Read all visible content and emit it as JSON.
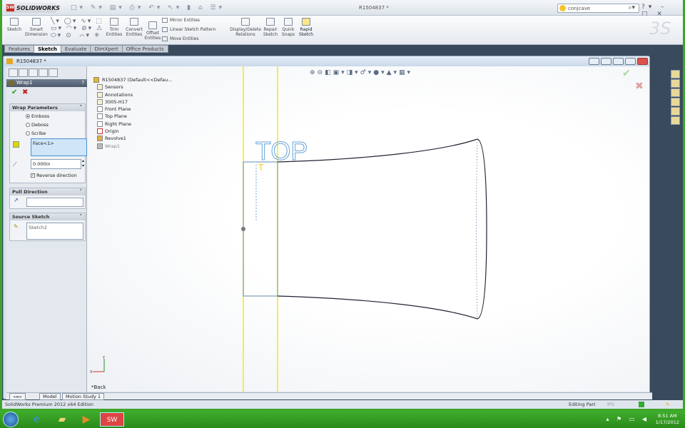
{
  "app": {
    "logo": "SOLIDWORKS",
    "doc_title": "R1504837 *",
    "search_value": "conjcave"
  },
  "ribbon": {
    "sketch": "Sketch",
    "smart_dimension": "Smart Dimension",
    "trim": "Trim Entities",
    "convert": "Convert Entities",
    "offset": "Offset Entities",
    "mirror": "Mirror Entities",
    "linear_pattern": "Linear Sketch Pattern",
    "move": "Move Entities",
    "display_relations": "Display/Delete Relations",
    "repair": "Repair Sketch",
    "quick_snaps": "Quick Snaps",
    "rapid_sketch": "Rapid Sketch"
  },
  "tabs": [
    {
      "label": "Features"
    },
    {
      "label": "Sketch"
    },
    {
      "label": "Evaluate"
    },
    {
      "label": "DimXpert"
    },
    {
      "label": "Office Products"
    }
  ],
  "document": {
    "title": "R1504837 *"
  },
  "property_manager": {
    "title": "Wrap1",
    "help": "?",
    "wrap_parameters": {
      "header": "Wrap Parameters",
      "options": [
        "Emboss",
        "Deboss",
        "Scribe"
      ],
      "selected": "Emboss",
      "face": "Face<1>",
      "depth": "0.000in",
      "reverse_direction_label": "Reverse direction",
      "reverse_direction": true
    },
    "pull_direction": {
      "header": "Pull Direction",
      "value": ""
    },
    "source_sketch": {
      "header": "Source Sketch",
      "value": "Sketch2"
    }
  },
  "tree": {
    "root": "R1504837 (Default<<Defau...",
    "items": [
      "Sensors",
      "Annotations",
      "3005-H17",
      "Front Plane",
      "Top Plane",
      "Right Plane",
      "Origin",
      "Revolve1",
      "Wrap1"
    ]
  },
  "graphics": {
    "sketch_text": "TOP",
    "view_label": "*Back"
  },
  "bottom_tabs": [
    "Model",
    "Motion Study 1"
  ],
  "status": {
    "edition": "SolidWorks Premium 2012 x64 Edition",
    "mode": "Editing Part",
    "units": "IPS"
  },
  "taskbar": {
    "time": "8:51 AM",
    "date": "1/17/2012"
  }
}
